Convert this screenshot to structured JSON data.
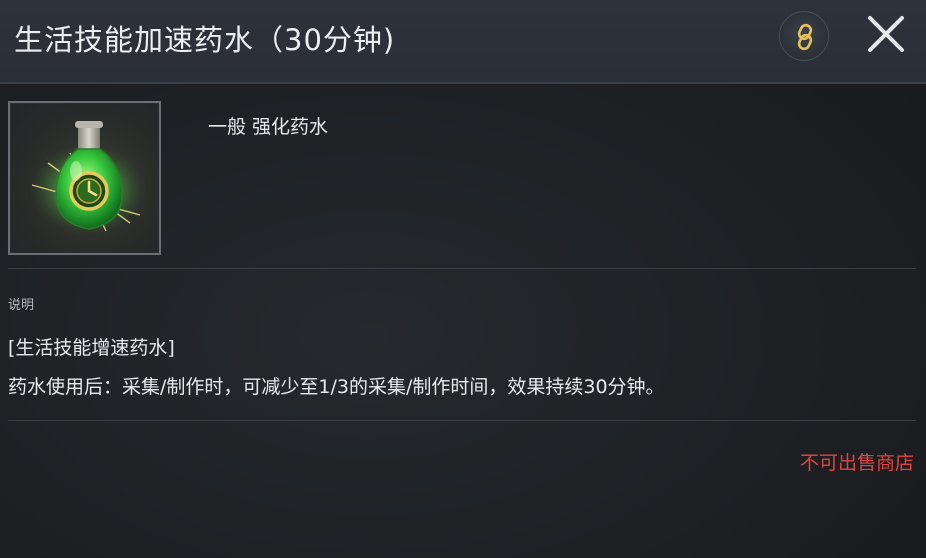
{
  "tooltip": {
    "title": "生活技能加速药水（30分钟)",
    "link_icon": "link-icon",
    "close_icon": "close-icon"
  },
  "item": {
    "icon": "green-potion-clock-icon",
    "grade_type": "一般 强化药水"
  },
  "description": {
    "section_label": "说明",
    "line1": "[生活技能增速药水]",
    "line2": "药水使用后：采集/制作时，可减少至1/3的采集/制作时间，效果持续30分钟。"
  },
  "restriction": {
    "text": "不可出售商店",
    "color": "#e04440"
  }
}
